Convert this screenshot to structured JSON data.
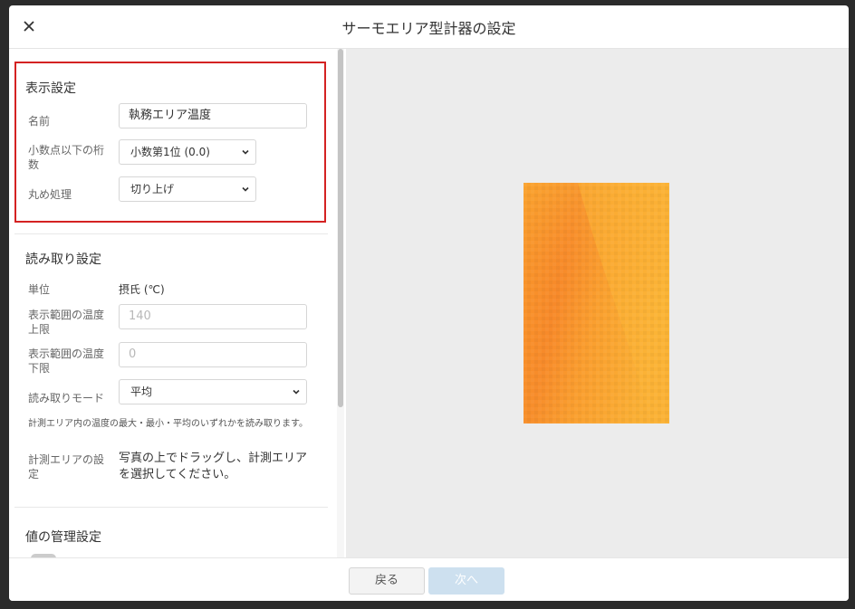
{
  "dialog": {
    "title": "サーモエリア型計器の設定"
  },
  "display_settings": {
    "section_title": "表示設定",
    "name_label": "名前",
    "name_value": "執務エリア温度",
    "decimal_label": "小数点以下の桁数",
    "decimal_value": "小数第1位 (0.0)",
    "rounding_label": "丸め処理",
    "rounding_value": "切り上げ"
  },
  "reading_settings": {
    "section_title": "読み取り設定",
    "unit_label": "単位",
    "unit_value": "摂氏 (℃)",
    "upper_label": "表示範囲の温度上限",
    "upper_placeholder": "140",
    "lower_label": "表示範囲の温度下限",
    "lower_placeholder": "0",
    "mode_label": "読み取りモード",
    "mode_value": "平均",
    "mode_note": "計測エリア内の温度の最大・最小・平均のいずれかを読み取ります。",
    "area_label": "計測エリアの設定",
    "area_value": "写真の上でドラッグし、計測エリアを選択してください。"
  },
  "value_management": {
    "section_title": "値の管理設定"
  },
  "footer": {
    "back_label": "戻る",
    "next_label": "次へ"
  },
  "colors": {
    "highlight_border": "#d42222",
    "thermal_hot": "#f7892a",
    "thermal_warm": "#fbb537",
    "next_button_disabled": "#cde0ef"
  }
}
